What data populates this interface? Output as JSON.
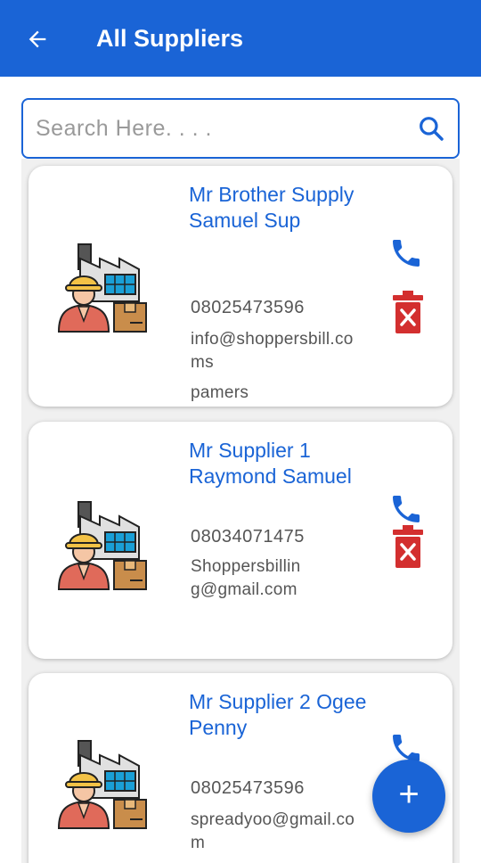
{
  "appbar": {
    "title": "All Suppliers",
    "back_icon": "arrow-left-icon"
  },
  "search": {
    "placeholder": "Search Here. . . .",
    "value": "",
    "icon": "search-icon"
  },
  "suppliers": [
    {
      "name": "Mr Brother Supply Samuel Sup",
      "phone": "08025473596",
      "email": "info@shoppersbill.coms",
      "note": "pamers"
    },
    {
      "name": "Mr Supplier 1 Raymond Samuel",
      "phone": "08034071475",
      "email": "Shoppersbilling@gmail.com",
      "note": ""
    },
    {
      "name": "Mr Supplier 2 Ogee Penny",
      "phone": "08025473596",
      "email": "spreadyoo@gmail.com",
      "note": ""
    }
  ],
  "fab": {
    "label": "+"
  },
  "colors": {
    "primary": "#1a64d6",
    "delete": "#d32f2f",
    "text_muted": "#555555"
  }
}
